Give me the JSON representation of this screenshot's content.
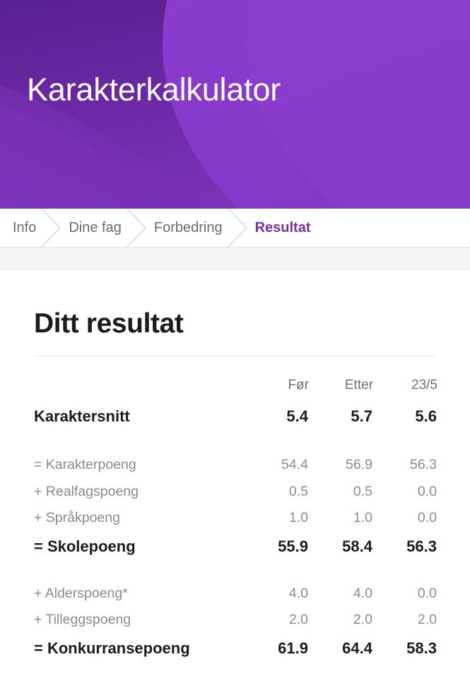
{
  "header": {
    "title": "Karakterkalkulator",
    "bg_dark": "#5d2392",
    "bg_light": "#8639cb",
    "bg_mid": "#7b32b8"
  },
  "breadcrumb": {
    "active_color": "#7b2fa8",
    "items": [
      {
        "label": "Info",
        "active": false
      },
      {
        "label": "Dine fag",
        "active": false
      },
      {
        "label": "Forbedring",
        "active": false
      },
      {
        "label": "Resultat",
        "active": true
      }
    ]
  },
  "main": {
    "page_title": "Ditt resultat",
    "table": {
      "column_headers": [
        "",
        "Før",
        "Etter",
        "23/5"
      ],
      "rows": [
        {
          "type": "main",
          "label": "Karaktersnitt",
          "values": [
            "5.4",
            "5.7",
            "5.6"
          ]
        },
        {
          "type": "sub",
          "label": "= Karakterpoeng",
          "values": [
            "54.4",
            "56.9",
            "56.3"
          ]
        },
        {
          "type": "sub",
          "label": "+ Realfagspoeng",
          "values": [
            "0.5",
            "0.5",
            "0.0"
          ]
        },
        {
          "type": "sub",
          "label": "+ Språkpoeng",
          "values": [
            "1.0",
            "1.0",
            "0.0"
          ]
        },
        {
          "type": "total",
          "label": "= Skolepoeng",
          "values": [
            "55.9",
            "58.4",
            "56.3"
          ]
        },
        {
          "type": "sub",
          "label": "+ Alderspoeng*",
          "values": [
            "4.0",
            "4.0",
            "0.0"
          ]
        },
        {
          "type": "sub",
          "label": "+ Tilleggspoeng",
          "values": [
            "2.0",
            "2.0",
            "2.0"
          ]
        },
        {
          "type": "total",
          "label": "= Konkurransepoeng",
          "values": [
            "61.9",
            "64.4",
            "58.3"
          ]
        }
      ]
    }
  }
}
